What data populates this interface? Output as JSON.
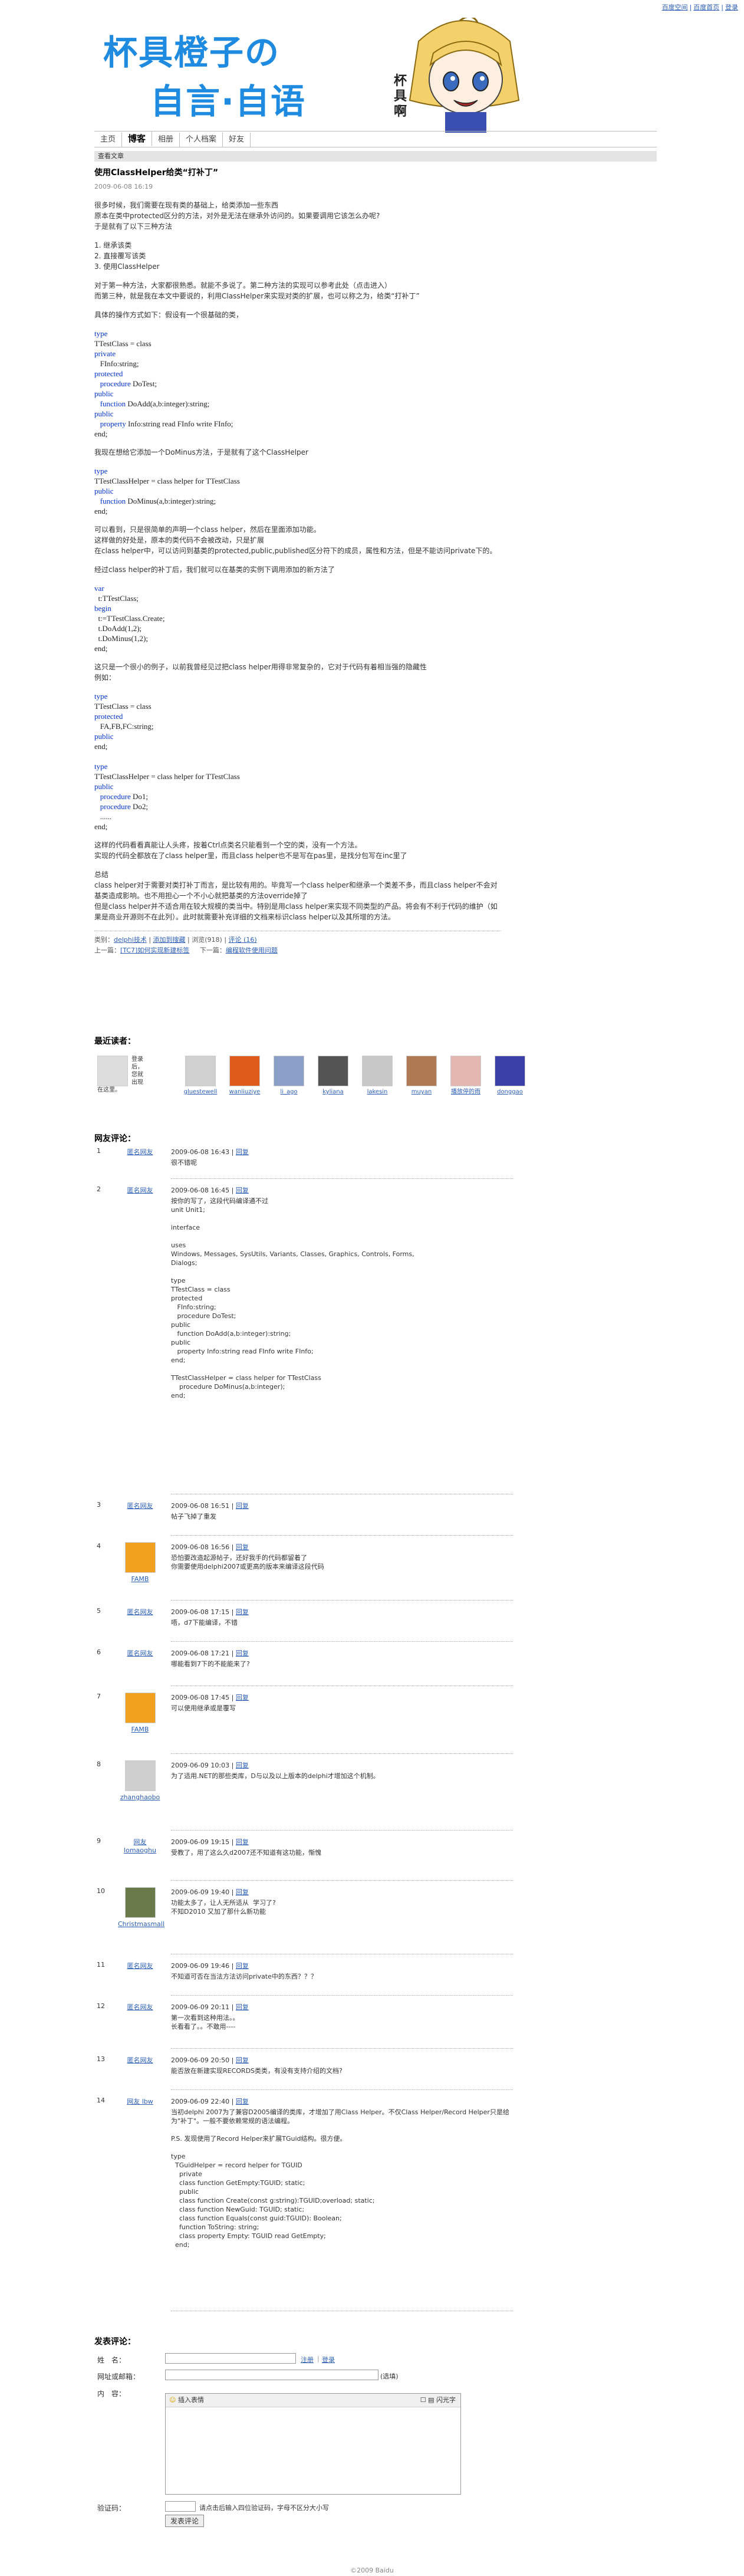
{
  "topbar": {
    "links": [
      "百度空间",
      "百度首页",
      "登录"
    ]
  },
  "banner": {
    "title_line1": "杯具橙子の",
    "title_line2": "自言·自语",
    "vertical_text": "杯具啊"
  },
  "nav": {
    "items": [
      "主页",
      "博客",
      "相册",
      "个人档案",
      "好友"
    ]
  },
  "crumb": "查看文章",
  "post": {
    "title": "使用ClassHelper给类“打补丁”",
    "date": "2009-06-08 16:19",
    "p1": "很多时候，我们需要在现有类的基础上，给类添加一些东西\n原本在类中protected区分的方法，对外是无法在继承外访问的。如果要调用它该怎么办呢?\n于是就有了以下三种方法",
    "p2": "1. 继承该类\n2. 直接覆写该类\n3. 使用ClassHelper",
    "p3": "对于第一种方法，大家都很熟悉。就能不多说了。第二种方法的实现可以参考此处（点击进入）\n而第三种，就是我在本文中要说的，利用ClassHelper来实现对类的扩展，也可以称之为，给类“打补丁”",
    "p4": "具体的操作方式如下：假设有一个很基础的类，",
    "code1": [
      "type",
      "TTestClass = class",
      "private",
      "   FInfo:string;",
      "protected",
      "   procedure DoTest;",
      "public",
      "   function DoAdd(a,b:integer):string;",
      "public",
      "   property Info:string read FInfo write FInfo;",
      "end;"
    ],
    "p5": "我现在想给它添加一个DoMinus方法，于是就有了这个ClassHelper",
    "code2": [
      "type",
      "TTestClassHelper = class helper for TTestClass",
      "public",
      "   function DoMinus(a,b:integer):string;",
      "end;"
    ],
    "p6": "可以看到，只是很简单的声明一个class helper，然后在里面添加功能。\n这样做的好处是，原本的类代码不会被改动，只是扩展\n在class helper中，可以访问到基类的protected,public,published区分符下的成员，属性和方法，但是不能访问private下的。",
    "p7": "经过class helper的补丁后，我们就可以在基类的实例下调用添加的新方法了",
    "code3": [
      "var",
      "  t:TTestClass;",
      "begin",
      "  t:=TTestClass.Create;",
      "  t.DoAdd(1,2);",
      "  t.DoMinus(1,2);",
      "end;"
    ],
    "p8": "这只是一个很小的例子，以前我曾经见过把class helper用得非常复杂的，它对于代码有着相当强的隐藏性\n例如：",
    "code4": [
      "type",
      "TTestClass = class",
      "protected",
      "   FA,FB,FC:string;",
      "public",
      "end;",
      "",
      "type",
      "TTestClassHelper = class helper for TTestClass",
      "public",
      "   procedure Do1;",
      "   procedure Do2;",
      "   ......",
      "end;"
    ],
    "p9": "这样的代码看看真能让人头疼，按着Ctrl点类名只能看到一个空的类，没有一个方法。\n实现的代码全都放在了class helper里，而且class helper也不是写在pas里，是找分包写在inc里了",
    "p10": "总结\nclass helper对于需要对类打补丁而言，是比较有用的。毕竟写一个class helper和继承一个类差不多，而且class helper不会对基类造成影响。也不用担心一个不小心就把基类的方法override掉了\n但是class helper并不适合用在较大规模的类当中。特别是用class helper来实现不同类型的产品。将会有不利于代码的维护（如果是商业开源则不在此列）。此时就需要补充详细的文档来标识class helper以及其所增的方法。",
    "meta1_label": "类别：",
    "meta1_link": "delphi技术",
    "meta1_add": "添加到搜藏",
    "meta1_stats": "浏览(918)",
    "meta1_comment": "评论 (16)",
    "meta2_prev_label": "上一篇：",
    "meta2_prev": "[TC7]如何实现新建标签",
    "meta2_next_label": "下一篇：",
    "meta2_next": "编程软件使用问题"
  },
  "visitors": {
    "title": "最近读者：",
    "login_text": "登录后，您就出现在这里。",
    "names": [
      "gluestewell",
      "wanliuziye",
      "li_ago",
      "kyliana",
      "lakesin",
      "muyan",
      "播放停的雨",
      "donggao"
    ]
  },
  "comments": {
    "title": "网友评论：",
    "items": [
      {
        "num": "1",
        "user": "匿名网友",
        "time": "2009-06-08 16:43",
        "reply": "回复",
        "text": "很不错呢"
      },
      {
        "num": "2",
        "user": "匿名网友",
        "time": "2009-06-08 16:45",
        "reply": "回复",
        "text": "按你的写了，这段代码编译通不过\nunit Unit1;\n\ninterface\n\nuses\nWindows, Messages, SysUtils, Variants, Classes, Graphics, Controls, Forms,\nDialogs;\n\ntype\nTTestClass = class\nprotected\n   FInfo:string;\n   procedure DoTest;\npublic\n   function DoAdd(a,b:integer):string;\npublic\n   property Info:string read FInfo write FInfo;\nend;\n\nTTestClassHelper = class helper for TTestClass\n    procedure DoMinus(a,b:integer);\nend;"
      },
      {
        "num": "3",
        "user": "匿名网友",
        "time": "2009-06-08 16:51",
        "reply": "回复",
        "text": "帖子飞掉了重发"
      },
      {
        "num": "4",
        "user": "FAMB",
        "time": "2009-06-08 16:56",
        "reply": "回复",
        "text": "恐怕要改造起源帖子，还好我手的代码都留着了\n你需要使用delphi2007或更高的版本来编译这段代码"
      },
      {
        "num": "5",
        "user": "匿名网友",
        "time": "2009-06-08 17:15",
        "reply": "回复",
        "text": "唔，d7下能编译，不错"
      },
      {
        "num": "6",
        "user": "匿名网友",
        "time": "2009-06-08 17:21",
        "reply": "回复",
        "text": "哪能看到7下的不能能来了?"
      },
      {
        "num": "7",
        "user": "FAMB",
        "time": "2009-06-08 17:45",
        "reply": "回复",
        "text": "可以使用继承或是覆写"
      },
      {
        "num": "8",
        "user": "zhanghaobo",
        "time": "2009-06-09 10:03",
        "reply": "回复",
        "text": "为了适用.NET的那些类库，D与以及以上版本的delphi才增加这个机制。"
      },
      {
        "num": "9",
        "user": "网友 lomaoghu",
        "time": "2009-06-09 19:15",
        "reply": "回复",
        "text": "受教了，用了这么久d2007还不知道有这功能，惭愧"
      },
      {
        "num": "10",
        "user": "Christmasmall",
        "time": "2009-06-09 19:40",
        "reply": "回复",
        "text": "功能太多了，让人无所适从  学习了?\n不知D2010 又加了那什么新功能"
      },
      {
        "num": "11",
        "user": "匿名网友",
        "time": "2009-06-09 19:46",
        "reply": "回复",
        "text": "不知道可否在当法方法访问private中的东西？？？"
      },
      {
        "num": "12",
        "user": "匿名网友",
        "time": "2009-06-09 20:11",
        "reply": "回复",
        "text": "第一次看到这种用法。。\n长看看了。。不敢用----"
      },
      {
        "num": "13",
        "user": "匿名网友",
        "time": "2009-06-09 20:50",
        "reply": "回复",
        "text": "能否放在新建实现RECORDS类类，有没有支持介绍的文档?"
      },
      {
        "num": "14",
        "user": "网友 lbw",
        "time": "2009-06-09 22:40",
        "reply": "回复",
        "text": "当初delphi 2007为了兼容D2005编译的类库，才增加了用Class Helper。不仅Class Helper/Record Helper只是给为\"补丁\"。一般不要依赖常规的语法编程。\n\nP.S. 发现使用了Record Helper来扩展TGuid结构。很方便。\n\ntype\n  TGuidHelper = record helper for TGUID\n    private\n    class function GetEmpty:TGUID; static;\n    public\n    class function Create(const g:string):TGUID;overload; static;\n    class function NewGuid: TGUID; static;\n    class function Equals(const guid:TGUID): Boolean;\n    function ToString: string;\n    class property Empty: TGUID read GetEmpty;\n  end;"
      }
    ]
  },
  "form": {
    "title": "发表评论：",
    "name_label": "姓　名：",
    "login_link": "注册",
    "login_link2": "登录",
    "url_label": "网址或邮箱：",
    "url_hint": "(选填)",
    "content_label": "内　容：",
    "editor_insert": "插入表情",
    "editor_quiet": "闪光字",
    "captcha_label": "验证码：",
    "captcha_hint": "请点击后输入四位验证码，字母不区分大小写",
    "submit": "发表评论"
  },
  "footer": "©2009 Baidu",
  "colors": {
    "title_blue": "#1e8be0",
    "link": "#2b5fb5",
    "keyword": "#0033cc"
  }
}
